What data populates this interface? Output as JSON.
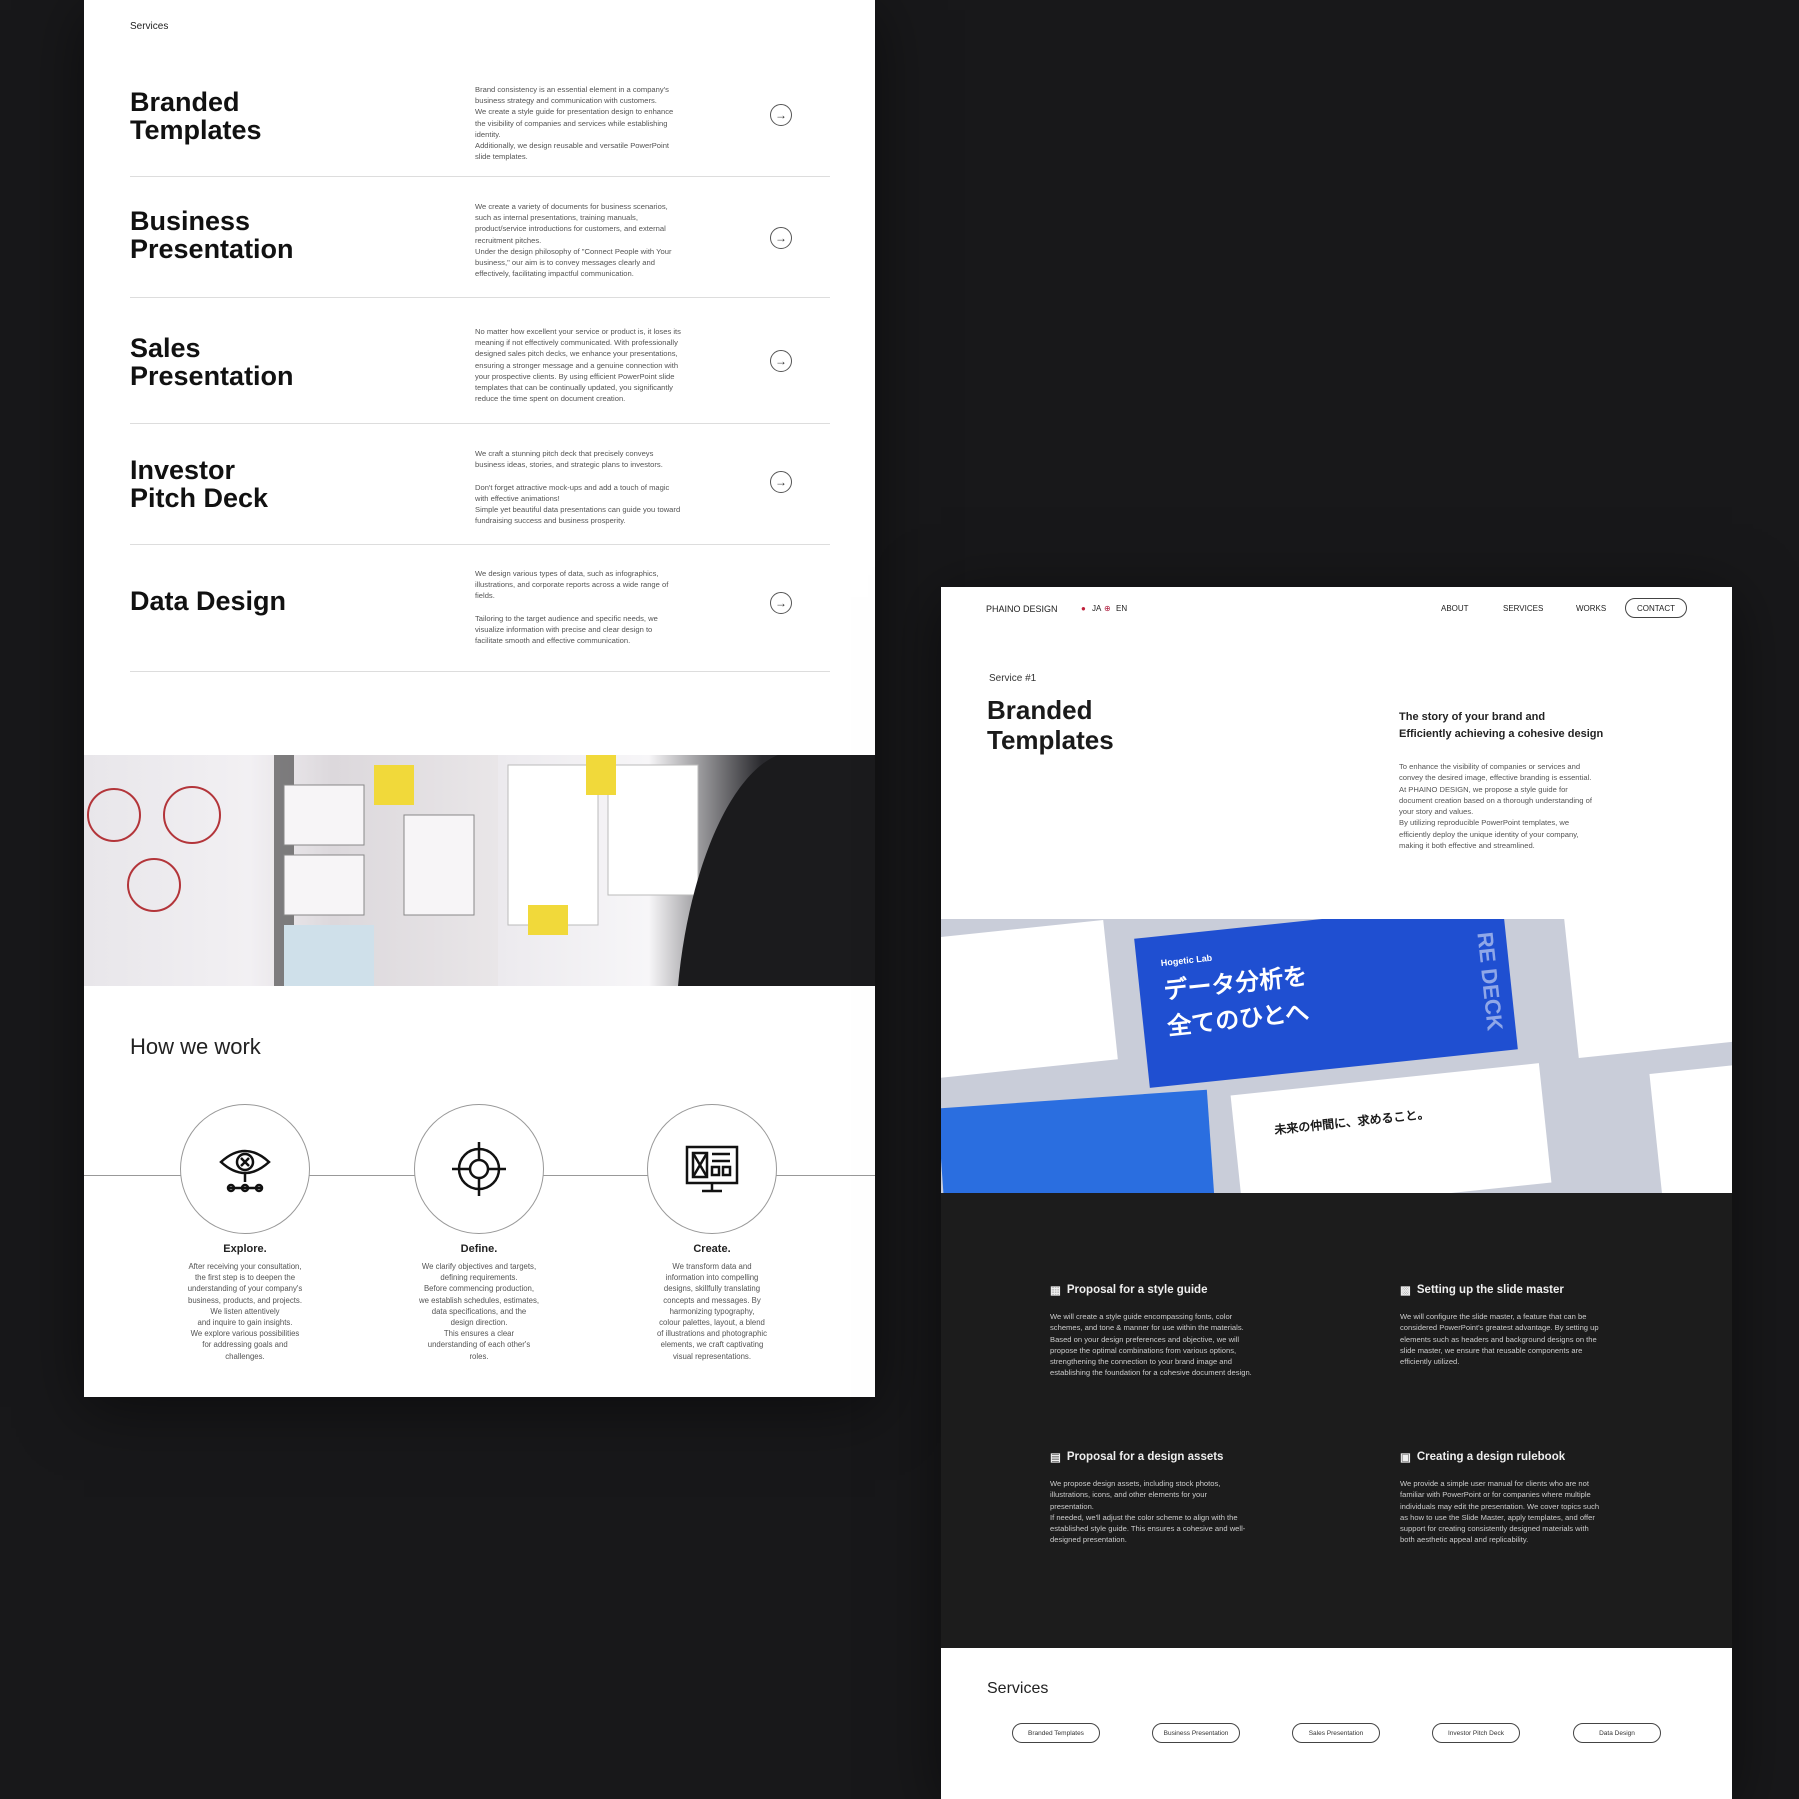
{
  "left": {
    "section_label": "Services",
    "services": [
      {
        "title": "Branded\nTemplates",
        "desc": "Brand consistency is an essential element in a company's\nbusiness strategy and communication with customers.\nWe create a style guide for presentation design to enhance\nthe visibility of companies and services while establishing\nidentity.\nAdditionally, we design reusable and versatile PowerPoint\nslide templates."
      },
      {
        "title": "Business\nPresentation",
        "desc": "We create a variety of documents for business scenarios,\nsuch as internal presentations, training manuals,\nproduct/service introductions for customers, and external\nrecruitment pitches.\nUnder the design philosophy of  \"Connect People with Your\nbusiness,\" our aim is to convey messages clearly and\neffectively, facilitating impactful communication."
      },
      {
        "title": "Sales\nPresentation",
        "desc": "No matter how excellent your service or product is, it loses its\nmeaning if not effectively communicated. With professionally\ndesigned sales pitch decks, we enhance your presentations,\nensuring a stronger message and a genuine connection with\nyour prospective clients. By using efficient PowerPoint slide\ntemplates that can be continually updated, you significantly\nreduce the time spent on document creation."
      },
      {
        "title": "Investor\nPitch Deck",
        "desc": "We craft a stunning pitch deck that precisely conveys\nbusiness ideas, stories, and strategic plans to investors.\n\nDon't forget  attractive mock-ups and add a touch of magic\nwith effective animations!\nSimple yet beautiful data presentations can guide you toward\nfundraising success and business prosperity."
      },
      {
        "title": "Data Design",
        "desc": "We design various types of data, such as infographics,\nillustrations, and corporate reports across a wide range of\nfields.\n\nTailoring to the target audience and specific needs, we\nvisualize information with precise and clear design to\nfacilitate smooth and effective communication."
      }
    ],
    "how_title": "How we work",
    "steps": [
      {
        "title": "Explore.",
        "icon": "eye-icon",
        "desc": "After receiving your consultation,\nthe first step is to deepen the\nunderstanding of your company's\nbusiness, products, and projects.\nWe listen attentively\nand inquire to gain insights.\nWe explore various possibilities\nfor addressing goals and\nchallenges."
      },
      {
        "title": "Define.",
        "icon": "target-icon",
        "desc": "We clarify objectives and targets,\ndefining requirements.\nBefore commencing production,\nwe establish schedules, estimates,\ndata specifications, and the\ndesign direction.\nThis ensures a clear\nunderstanding of each other's\nroles."
      },
      {
        "title": "Create.",
        "icon": "layout-icon",
        "desc": "We transform data and\ninformation into compelling\ndesigns, skillfully translating\nconcepts and messages. By\nharmonizing typography,\ncolour palettes, layout, a blend\nof illustrations and photographic\nelements, we craft captivating\nvisual representations."
      }
    ]
  },
  "right": {
    "brand": "PHAINO DESIGN",
    "lang_ja": "JA",
    "lang_en": "EN",
    "nav": [
      "ABOUT",
      "SERVICES",
      "WORKS"
    ],
    "contact": "CONTACT",
    "eyebrow": "Service #1",
    "title": "Branded\nTemplates",
    "tagline": "The story of your brand and\nEfficiently achieving a cohesive design",
    "body": "To enhance the visibility of companies or services and\nconvey the desired image, effective branding is essential.\nAt PHAINO DESIGN, we propose a style guide for\ndocument creation based on a thorough understanding of\nyour story and values.\nBy utilizing reproducible PowerPoint templates, we\nefficiently deploy the unique identity of your company,\nmaking it both effective and streamlined.",
    "mock": {
      "logo": "Hogetic Lab",
      "headline": "データ分析を\n全てのひとへ",
      "side": "RE DECK",
      "slide2": "未来の仲間に、求めること。"
    },
    "features": [
      {
        "title": "Proposal for a style guide",
        "desc": "We will create a style guide encompassing fonts, color\nschemes, and tone & manner for use within the materials.\nBased on your design preferences and objective, we will\npropose the optimal combinations from various options,\nstrengthening the connection to your brand image and\nestablishing the foundation for a cohesive document design."
      },
      {
        "title": "Setting up the slide master",
        "desc": "We will configure the slide master, a feature that can be\nconsidered PowerPoint's greatest advantage. By setting up\nelements such as headers and background designs on the\nslide master, we ensure that reusable components are\nefficiently utilized."
      },
      {
        "title": "Proposal for a design assets",
        "desc": "We propose design assets, including stock photos,\nillustrations, icons, and other elements for your\npresentation.\nIf needed, we'll adjust the color scheme to align with the\nestablished style guide. This ensures a cohesive and well-\ndesigned presentation."
      },
      {
        "title": "Creating a design rulebook",
        "desc": "We provide a simple user manual for clients who are not\nfamiliar with PowerPoint or for companies where multiple\nindividuals may edit the presentation. We cover topics such\nas how to use the Slide Master, apply templates, and offer\nsupport for creating consistently designed materials with\nboth aesthetic appeal and replicability."
      }
    ],
    "services_title": "Services",
    "service_pills": [
      "Branded Templates",
      "Business Presentation",
      "Sales Presentation",
      "Investor Pitch Deck",
      "Data Design"
    ]
  },
  "colors": {
    "page_bg": "#18181a",
    "dark_section": "#1c1c1c",
    "mock_blue": "#1f4fd1"
  }
}
